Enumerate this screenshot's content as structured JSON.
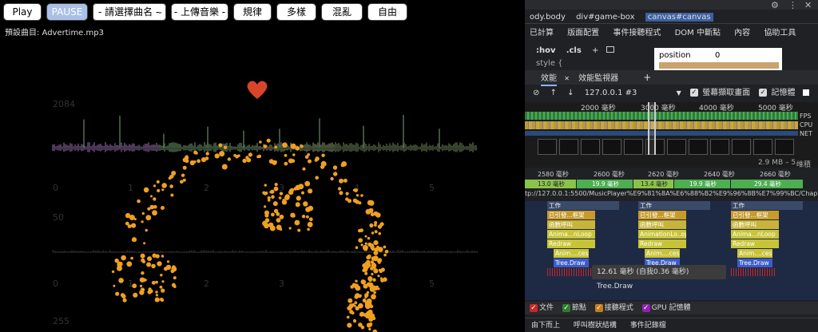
{
  "toolbar": {
    "play_label": "Play",
    "pause_label": "PAUSE",
    "select_song": "- 請選擇曲名 -",
    "upload_label": "- 上傳音樂 -",
    "mode1": "規律",
    "mode2": "多樣",
    "mode3": "混亂",
    "mode4": "自由"
  },
  "file_label": "預設曲目: Advertime.mp3",
  "viz": {
    "top_axis_max": "2084",
    "mid_axis_max": "50",
    "bottom_axis_max": "255",
    "top_ticks": [
      "0",
      "1",
      "2",
      "3",
      "4",
      "5"
    ],
    "mid_ticks": [
      "0",
      "1",
      "2",
      "3",
      "4",
      "5"
    ],
    "heart_color": "#d9452b",
    "particle_color": "#f0a020"
  },
  "devtools": {
    "breadcrumb": [
      "ody.body",
      "div#game-box",
      "canvas#canvas"
    ],
    "elements_tabs": [
      "已計算",
      "版面配置",
      "事件接聽程式",
      "DOM 中斷點",
      "內容",
      "協助工具"
    ],
    "style_filter": [
      ":hov",
      ".cls"
    ],
    "style_text": "style {",
    "position_label": "position",
    "position_value": "0",
    "panel_tabs": [
      "效能",
      "效能監視器"
    ],
    "address": "127.0.0.1 #3",
    "screenshot_label": "螢幕擷取畫面",
    "memory_label": "記憶體",
    "overview_ticks": [
      "2000 毫秒",
      "3000 毫秒",
      "4000 毫秒",
      "5000 毫秒"
    ],
    "track_labels": [
      "FPS",
      "CPU",
      "NET"
    ],
    "heap_label": "2.9 MB – 5.",
    "heap_suffix": "堆積",
    "timeline_ticks": [
      "2580 毫秒",
      "2600 毫秒",
      "2620 毫秒",
      "2640 毫秒",
      "2660 毫秒"
    ],
    "frames": [
      "13.0 毫秒",
      "19.9 毫秒",
      "13.4 毫秒",
      "19.9 毫秒",
      "29.4 毫秒"
    ],
    "url": "tp://127.0.0.1:5500/MusicPlayer%E9%81%8A%E6%88%B2%E9%96%8B%E7%99%BC/Chapter5/",
    "flame_rows": [
      "工作",
      "已引發...框架",
      "函數呼叫",
      "Anima...nLoop",
      "Redraw",
      "Anim....cess",
      "Tree.Draw"
    ],
    "flame_rows_b": [
      "工作",
      "已引發...框架",
      "函數呼叫",
      "AnimationLo..op",
      "Redraw",
      "Anim....cess",
      "Tree.Draw"
    ],
    "tooltip": "12.61 毫秒 (自我0.36 毫秒) Tree.Draw",
    "legend": [
      "文件",
      "節點",
      "接聽程式",
      "GPU 記憶體"
    ],
    "bottom_tabs": [
      "由下而上",
      "呼叫樹狀結構",
      "事件記錄檔"
    ],
    "colors": {
      "green": "#3fa34d",
      "yellow": "#d9c13b",
      "purple": "#8e4fb3",
      "blue": "#4261c9",
      "lightgreen": "#8bc34a"
    }
  }
}
